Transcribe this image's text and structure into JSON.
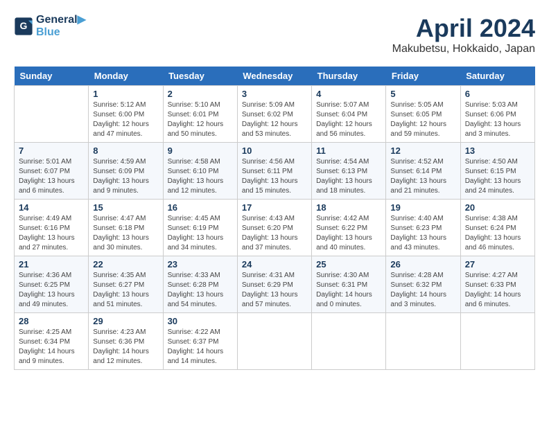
{
  "header": {
    "logo_line1": "General",
    "logo_line2": "Blue",
    "month_title": "April 2024",
    "location": "Makubetsu, Hokkaido, Japan"
  },
  "days_of_week": [
    "Sunday",
    "Monday",
    "Tuesday",
    "Wednesday",
    "Thursday",
    "Friday",
    "Saturday"
  ],
  "weeks": [
    [
      {
        "day": "",
        "info": ""
      },
      {
        "day": "1",
        "info": "Sunrise: 5:12 AM\nSunset: 6:00 PM\nDaylight: 12 hours\nand 47 minutes."
      },
      {
        "day": "2",
        "info": "Sunrise: 5:10 AM\nSunset: 6:01 PM\nDaylight: 12 hours\nand 50 minutes."
      },
      {
        "day": "3",
        "info": "Sunrise: 5:09 AM\nSunset: 6:02 PM\nDaylight: 12 hours\nand 53 minutes."
      },
      {
        "day": "4",
        "info": "Sunrise: 5:07 AM\nSunset: 6:04 PM\nDaylight: 12 hours\nand 56 minutes."
      },
      {
        "day": "5",
        "info": "Sunrise: 5:05 AM\nSunset: 6:05 PM\nDaylight: 12 hours\nand 59 minutes."
      },
      {
        "day": "6",
        "info": "Sunrise: 5:03 AM\nSunset: 6:06 PM\nDaylight: 13 hours\nand 3 minutes."
      }
    ],
    [
      {
        "day": "7",
        "info": "Sunrise: 5:01 AM\nSunset: 6:07 PM\nDaylight: 13 hours\nand 6 minutes."
      },
      {
        "day": "8",
        "info": "Sunrise: 4:59 AM\nSunset: 6:09 PM\nDaylight: 13 hours\nand 9 minutes."
      },
      {
        "day": "9",
        "info": "Sunrise: 4:58 AM\nSunset: 6:10 PM\nDaylight: 13 hours\nand 12 minutes."
      },
      {
        "day": "10",
        "info": "Sunrise: 4:56 AM\nSunset: 6:11 PM\nDaylight: 13 hours\nand 15 minutes."
      },
      {
        "day": "11",
        "info": "Sunrise: 4:54 AM\nSunset: 6:13 PM\nDaylight: 13 hours\nand 18 minutes."
      },
      {
        "day": "12",
        "info": "Sunrise: 4:52 AM\nSunset: 6:14 PM\nDaylight: 13 hours\nand 21 minutes."
      },
      {
        "day": "13",
        "info": "Sunrise: 4:50 AM\nSunset: 6:15 PM\nDaylight: 13 hours\nand 24 minutes."
      }
    ],
    [
      {
        "day": "14",
        "info": "Sunrise: 4:49 AM\nSunset: 6:16 PM\nDaylight: 13 hours\nand 27 minutes."
      },
      {
        "day": "15",
        "info": "Sunrise: 4:47 AM\nSunset: 6:18 PM\nDaylight: 13 hours\nand 30 minutes."
      },
      {
        "day": "16",
        "info": "Sunrise: 4:45 AM\nSunset: 6:19 PM\nDaylight: 13 hours\nand 34 minutes."
      },
      {
        "day": "17",
        "info": "Sunrise: 4:43 AM\nSunset: 6:20 PM\nDaylight: 13 hours\nand 37 minutes."
      },
      {
        "day": "18",
        "info": "Sunrise: 4:42 AM\nSunset: 6:22 PM\nDaylight: 13 hours\nand 40 minutes."
      },
      {
        "day": "19",
        "info": "Sunrise: 4:40 AM\nSunset: 6:23 PM\nDaylight: 13 hours\nand 43 minutes."
      },
      {
        "day": "20",
        "info": "Sunrise: 4:38 AM\nSunset: 6:24 PM\nDaylight: 13 hours\nand 46 minutes."
      }
    ],
    [
      {
        "day": "21",
        "info": "Sunrise: 4:36 AM\nSunset: 6:25 PM\nDaylight: 13 hours\nand 49 minutes."
      },
      {
        "day": "22",
        "info": "Sunrise: 4:35 AM\nSunset: 6:27 PM\nDaylight: 13 hours\nand 51 minutes."
      },
      {
        "day": "23",
        "info": "Sunrise: 4:33 AM\nSunset: 6:28 PM\nDaylight: 13 hours\nand 54 minutes."
      },
      {
        "day": "24",
        "info": "Sunrise: 4:31 AM\nSunset: 6:29 PM\nDaylight: 13 hours\nand 57 minutes."
      },
      {
        "day": "25",
        "info": "Sunrise: 4:30 AM\nSunset: 6:31 PM\nDaylight: 14 hours\nand 0 minutes."
      },
      {
        "day": "26",
        "info": "Sunrise: 4:28 AM\nSunset: 6:32 PM\nDaylight: 14 hours\nand 3 minutes."
      },
      {
        "day": "27",
        "info": "Sunrise: 4:27 AM\nSunset: 6:33 PM\nDaylight: 14 hours\nand 6 minutes."
      }
    ],
    [
      {
        "day": "28",
        "info": "Sunrise: 4:25 AM\nSunset: 6:34 PM\nDaylight: 14 hours\nand 9 minutes."
      },
      {
        "day": "29",
        "info": "Sunrise: 4:23 AM\nSunset: 6:36 PM\nDaylight: 14 hours\nand 12 minutes."
      },
      {
        "day": "30",
        "info": "Sunrise: 4:22 AM\nSunset: 6:37 PM\nDaylight: 14 hours\nand 14 minutes."
      },
      {
        "day": "",
        "info": ""
      },
      {
        "day": "",
        "info": ""
      },
      {
        "day": "",
        "info": ""
      },
      {
        "day": "",
        "info": ""
      }
    ]
  ]
}
